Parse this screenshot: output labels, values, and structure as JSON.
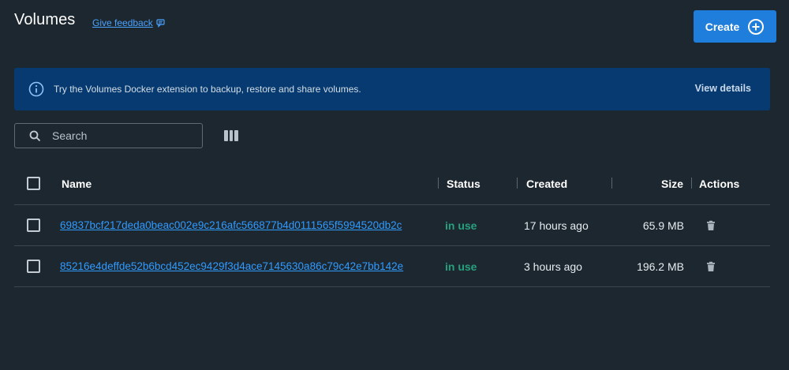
{
  "header": {
    "title": "Volumes",
    "feedback_label": "Give feedback",
    "create_label": "Create"
  },
  "banner": {
    "text": "Try the Volumes Docker extension to backup, restore and share volumes.",
    "link_label": "View details"
  },
  "search": {
    "placeholder": "Search",
    "value": ""
  },
  "table": {
    "columns": [
      "Name",
      "Status",
      "Created",
      "Size",
      "Actions"
    ],
    "rows": [
      {
        "name": "69837bcf217deda0beac002e9c216afc566877b4d0111565f5994520db2c",
        "status": "in use",
        "created": "17 hours ago",
        "size": "65.9 MB"
      },
      {
        "name": "85216e4deffde52b6bcd452ec9429f3d4ace7145630a86c79c42e7bb142e",
        "status": "in use",
        "created": "3 hours ago",
        "size": "196.2 MB"
      }
    ]
  },
  "colors": {
    "background": "#1d2730",
    "accent": "#1f7ddb",
    "banner": "#063a70",
    "link": "#2f9bff",
    "status_in_use": "#26a17e"
  },
  "icons": {
    "feedback": "chat-bubble-icon",
    "create": "plus-circle-icon",
    "banner": "info-icon",
    "search": "search-icon",
    "columns": "columns-icon",
    "delete": "trash-icon"
  }
}
